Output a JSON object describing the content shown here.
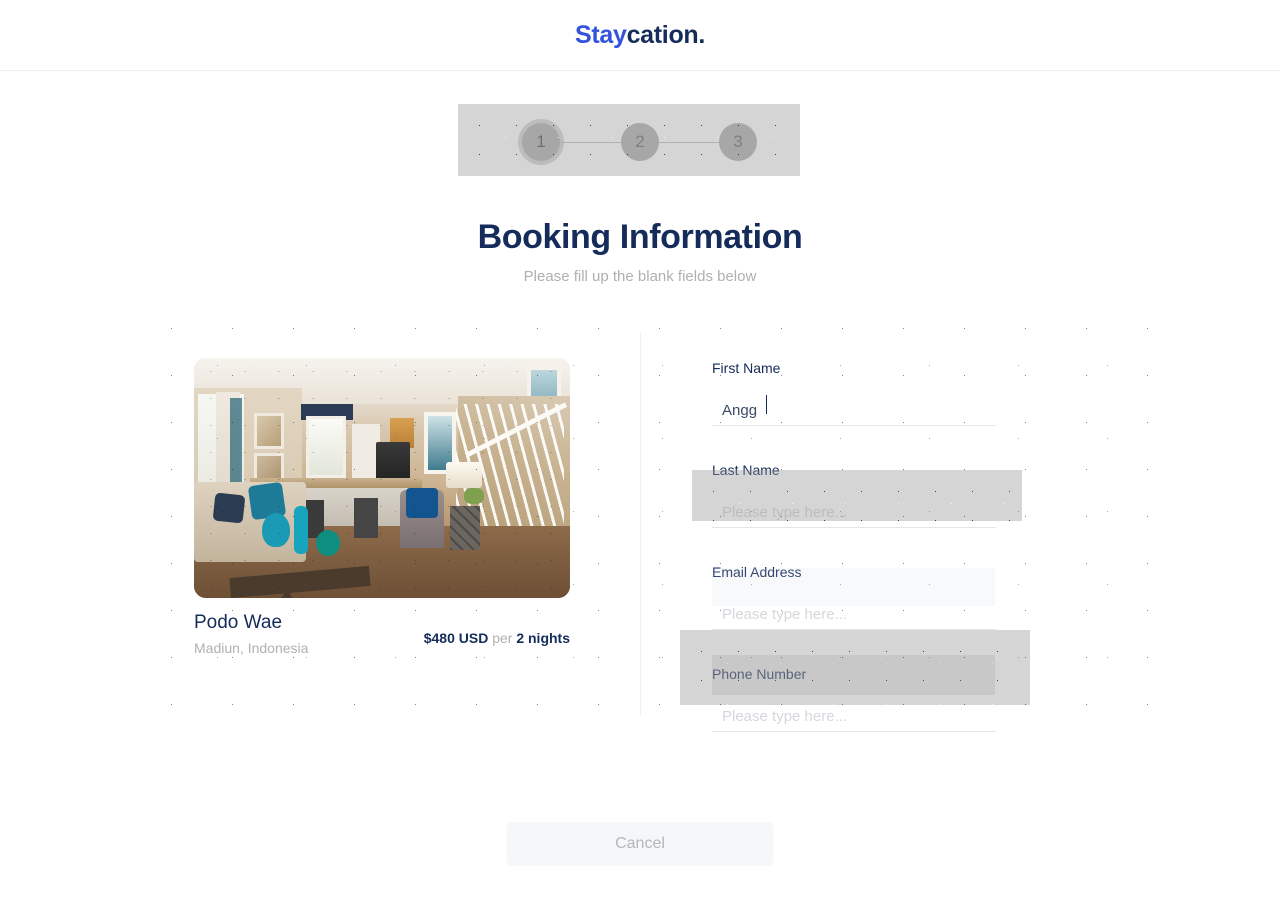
{
  "header": {
    "logo_accent": "Stay",
    "logo_rest": "cation.",
    "accent_color": "#3252df",
    "text_color": "#152c5b"
  },
  "stepper": {
    "steps": [
      {
        "number": "1",
        "state": "active"
      },
      {
        "number": "2",
        "state": "inactive"
      },
      {
        "number": "3",
        "state": "inactive"
      }
    ]
  },
  "page": {
    "title": "Booking Information",
    "subtitle": "Please fill up the blank fields below"
  },
  "property": {
    "name": "Podo Wae",
    "location": "Madiun, Indonesia",
    "price": "$480 USD",
    "per_label": "per",
    "duration": "2 nights",
    "image_alt": "living-room-photo"
  },
  "form": {
    "fields": [
      {
        "label": "First Name",
        "value": "Angg",
        "placeholder": "Please type here..."
      },
      {
        "label": "Last Name",
        "value": "",
        "placeholder": "Please type here..."
      },
      {
        "label": "Email Address",
        "value": "",
        "placeholder": "Please type here..."
      },
      {
        "label": "Phone Number",
        "value": "",
        "placeholder": "Please type here..."
      }
    ]
  },
  "actions": {
    "cancel_label": "Cancel"
  }
}
